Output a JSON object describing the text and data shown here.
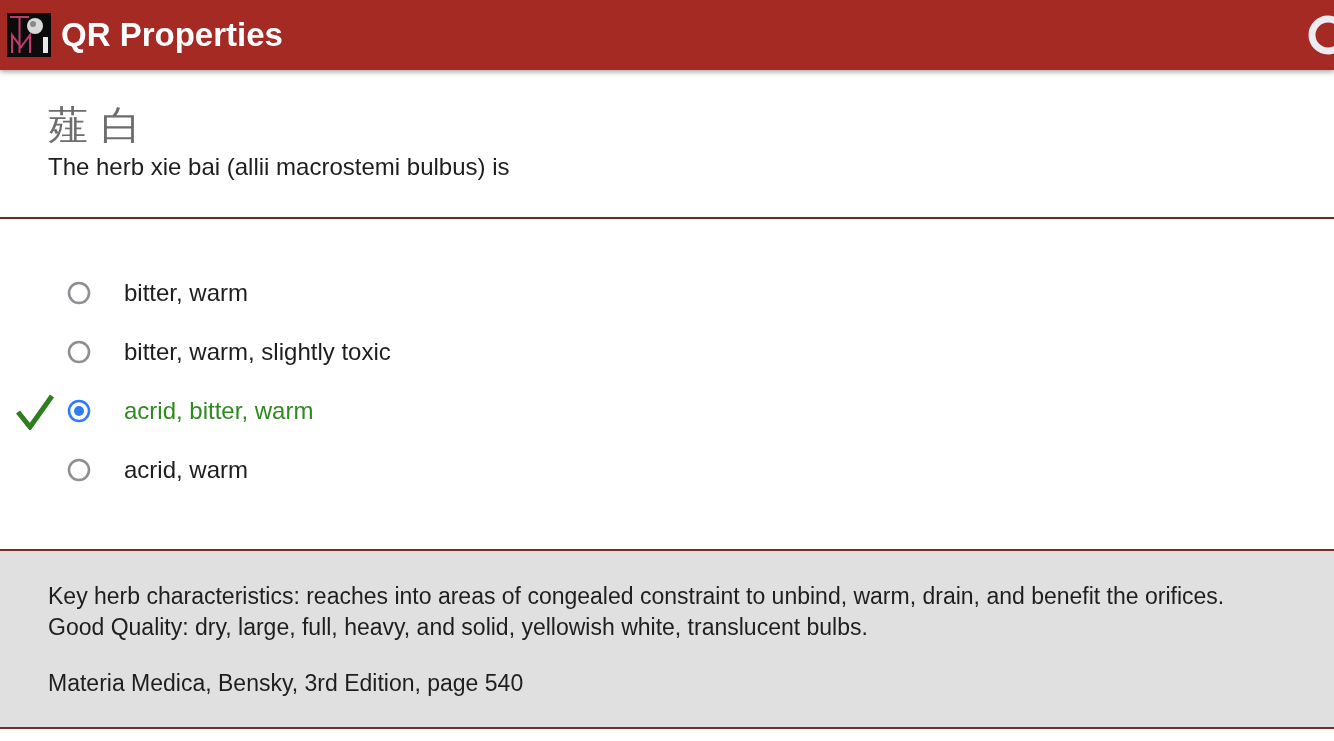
{
  "header": {
    "title": "QR Properties"
  },
  "question": {
    "chinese": "薤 白",
    "text": "The herb xie bai (allii macrostemi bulbus) is"
  },
  "options": [
    {
      "label": "bitter, warm",
      "selected": false,
      "correct": false
    },
    {
      "label": "bitter, warm, slightly toxic",
      "selected": false,
      "correct": false
    },
    {
      "label": "acrid, bitter, warm",
      "selected": true,
      "correct": true
    },
    {
      "label": "acrid, warm",
      "selected": false,
      "correct": false
    }
  ],
  "notes": {
    "lines": [
      "Key herb characteristics: reaches into areas of congealed constraint to unbind, warm, drain, and benefit the orifices.",
      "Good Quality: dry, large, full, heavy, and solid, yellowish white, translucent bulbs."
    ],
    "source": "Materia Medica, Bensky, 3rd Edition, page 540"
  }
}
